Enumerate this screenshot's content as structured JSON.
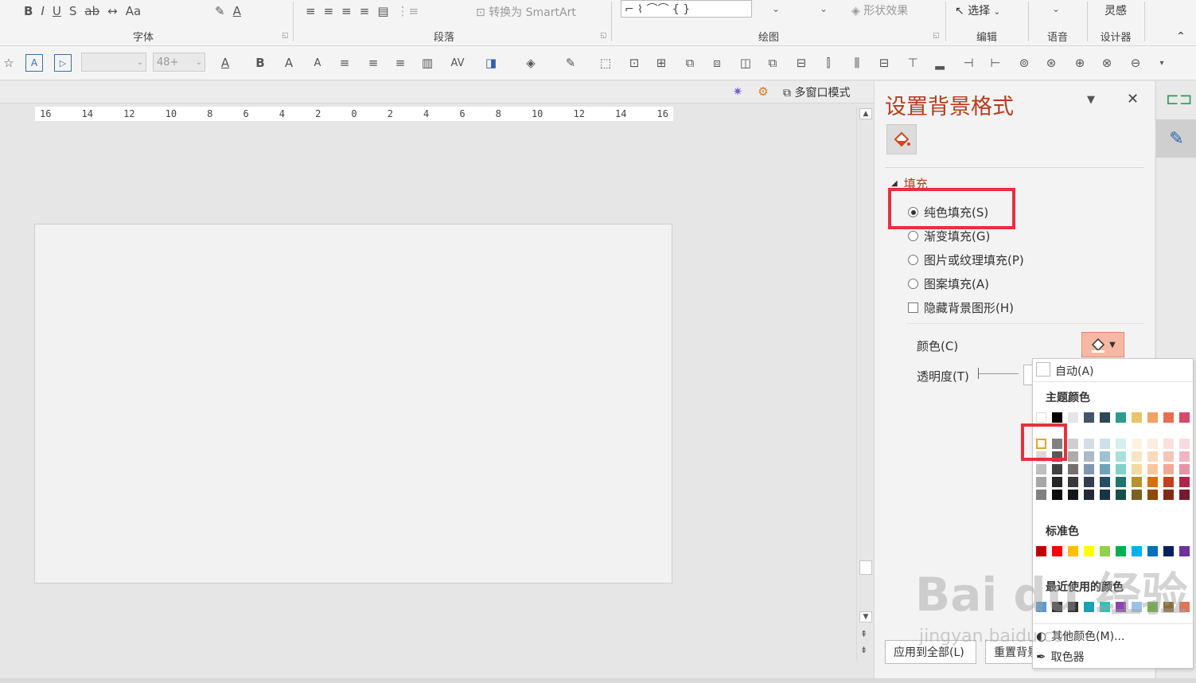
{
  "ribbon": {
    "groups": [
      {
        "label": "字体"
      },
      {
        "label": "段落"
      },
      {
        "label": "绘图"
      },
      {
        "label": "编辑"
      },
      {
        "label": "语音"
      },
      {
        "label": "设计器"
      }
    ],
    "font_case_label": "Aa",
    "convert_smartart": "转换为 SmartArt",
    "shape_effects": "形状效果",
    "select_label": "选择",
    "designer_top": "灵感"
  },
  "toolbar": {
    "font_size": "48+",
    "bold": "B",
    "grow": "A",
    "shrink": "A"
  },
  "viewbar": {
    "multiwindow": "多窗口模式"
  },
  "ruler": {
    "ticks": [
      "16",
      "14",
      "12",
      "10",
      "8",
      "6",
      "4",
      "2",
      "0",
      "2",
      "4",
      "6",
      "8",
      "10",
      "12",
      "14",
      "16"
    ]
  },
  "pane": {
    "title": "设置背景格式",
    "section": "填充",
    "options": [
      {
        "label": "纯色填充(S)",
        "checked": true
      },
      {
        "label": "渐变填充(G)",
        "checked": false
      },
      {
        "label": "图片或纹理填充(P)",
        "checked": false
      },
      {
        "label": "图案填充(A)",
        "checked": false
      }
    ],
    "hide_bg": "隐藏背景图形(H)",
    "color_label": "颜色(C)",
    "transparency_label": "透明度(T)",
    "apply_all": "应用到全部(L)",
    "reset": "重置背景(B)"
  },
  "dropdown": {
    "auto": "自动(A)",
    "theme_colors": "主题颜色",
    "standard_colors": "标准色",
    "recent_colors": "最近使用的颜色",
    "more_colors": "其他颜色(M)...",
    "eyedropper": "取色器",
    "theme_top": [
      "#ffffff",
      "#000000",
      "#e7e6e6",
      "#44546a",
      "#2f4858",
      "#2a9d8f",
      "#e9c46a",
      "#f4a261",
      "#e76f51",
      "#d64a6b"
    ],
    "theme_columns": [
      [
        "#f2f2f2",
        "#d9d9d9",
        "#bfbfbf",
        "#a6a6a6",
        "#808080"
      ],
      [
        "#7f7f7f",
        "#595959",
        "#404040",
        "#262626",
        "#0d0d0d"
      ],
      [
        "#d0cece",
        "#aeabab",
        "#757171",
        "#3a3838",
        "#171616"
      ],
      [
        "#d6dce4",
        "#adb9ca",
        "#8497b0",
        "#333f50",
        "#222a35"
      ],
      [
        "#cfe0e8",
        "#9fc2d1",
        "#6fa3ba",
        "#234e63",
        "#173442"
      ],
      [
        "#d4f0ec",
        "#a9e1d9",
        "#7ed2c6",
        "#1f766b",
        "#154f47"
      ],
      [
        "#fbf3e1",
        "#f6e6c3",
        "#f2daa5",
        "#b7922c",
        "#7a611d"
      ],
      [
        "#fdecdf",
        "#fbd9bf",
        "#f8c7a0",
        "#d6700f",
        "#8f4a0a"
      ],
      [
        "#fae2dc",
        "#f5c5b9",
        "#f1a997",
        "#c1401f",
        "#812b15"
      ],
      [
        "#f7dbe1",
        "#efb7c4",
        "#e693a6",
        "#b02549",
        "#751931"
      ]
    ],
    "standard": [
      "#c00000",
      "#ff0000",
      "#ffc000",
      "#ffff00",
      "#92d050",
      "#00b050",
      "#00b0f0",
      "#0070c0",
      "#002060",
      "#7030a0"
    ],
    "recent": [
      "#5b9bd5",
      "#333333",
      "#2f2f2f",
      "#17a2b8",
      "#2ec4b6",
      "#8e44ad",
      "#9dc3e6",
      "#70ad47",
      "#8b6d3a",
      "#e2725b"
    ],
    "auto_swatch": "#ffffff"
  },
  "accent": "#b83b1e",
  "highlight": "#e6303e",
  "watermark": {
    "main": "Bai du 经验",
    "sub": "jingyan.baidu.com"
  }
}
